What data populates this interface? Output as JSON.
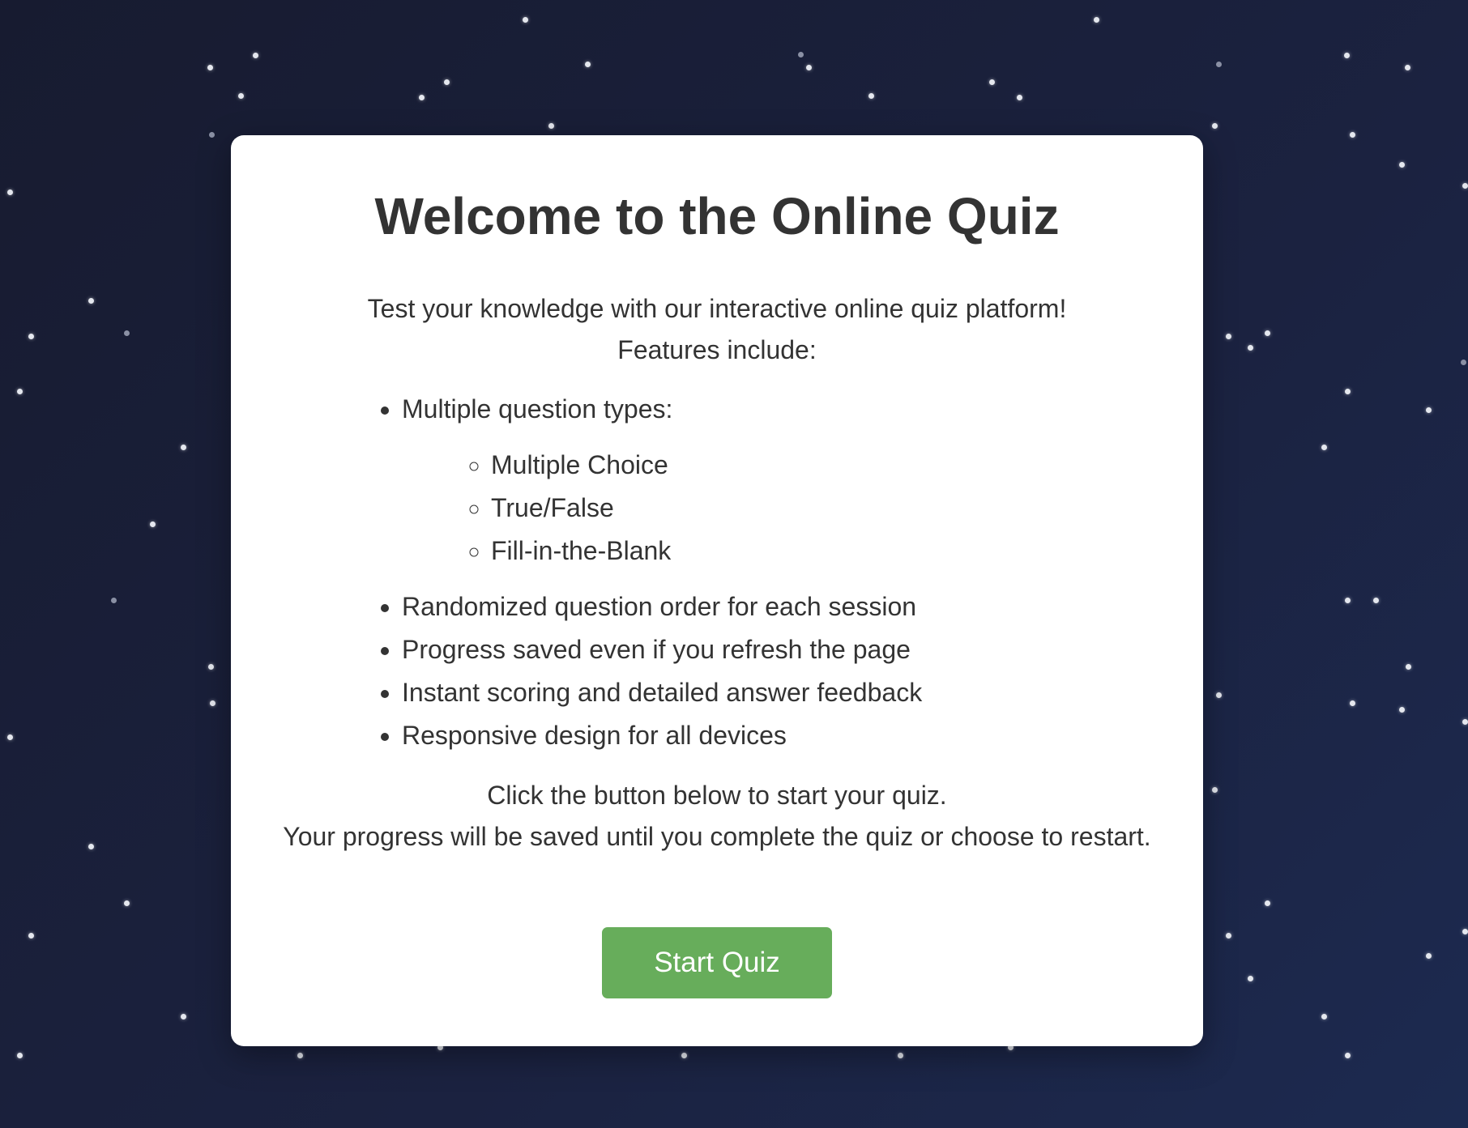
{
  "page": {
    "title": "Welcome to the Online Quiz",
    "intro_line1": "Test your knowledge with our interactive online quiz platform!",
    "intro_line2": "Features include:",
    "features": [
      {
        "label": "Multiple question types:",
        "sub_items": [
          "Multiple Choice",
          "True/False",
          "Fill-in-the-Blank"
        ]
      },
      {
        "label": "Randomized question order for each session"
      },
      {
        "label": "Progress saved even if you refresh the page"
      },
      {
        "label": "Instant scoring and detailed answer feedback"
      },
      {
        "label": "Responsive design for all devices"
      }
    ],
    "outro_line1": "Click the button below to start your quiz.",
    "outro_line2": "Your progress will be saved until you complete the quiz or choose to restart.",
    "start_button_label": "Start Quiz"
  },
  "colors": {
    "background": "#1b2240",
    "card": "#ffffff",
    "text": "#333333",
    "button": "#67ad5b",
    "button_text": "#ffffff"
  }
}
